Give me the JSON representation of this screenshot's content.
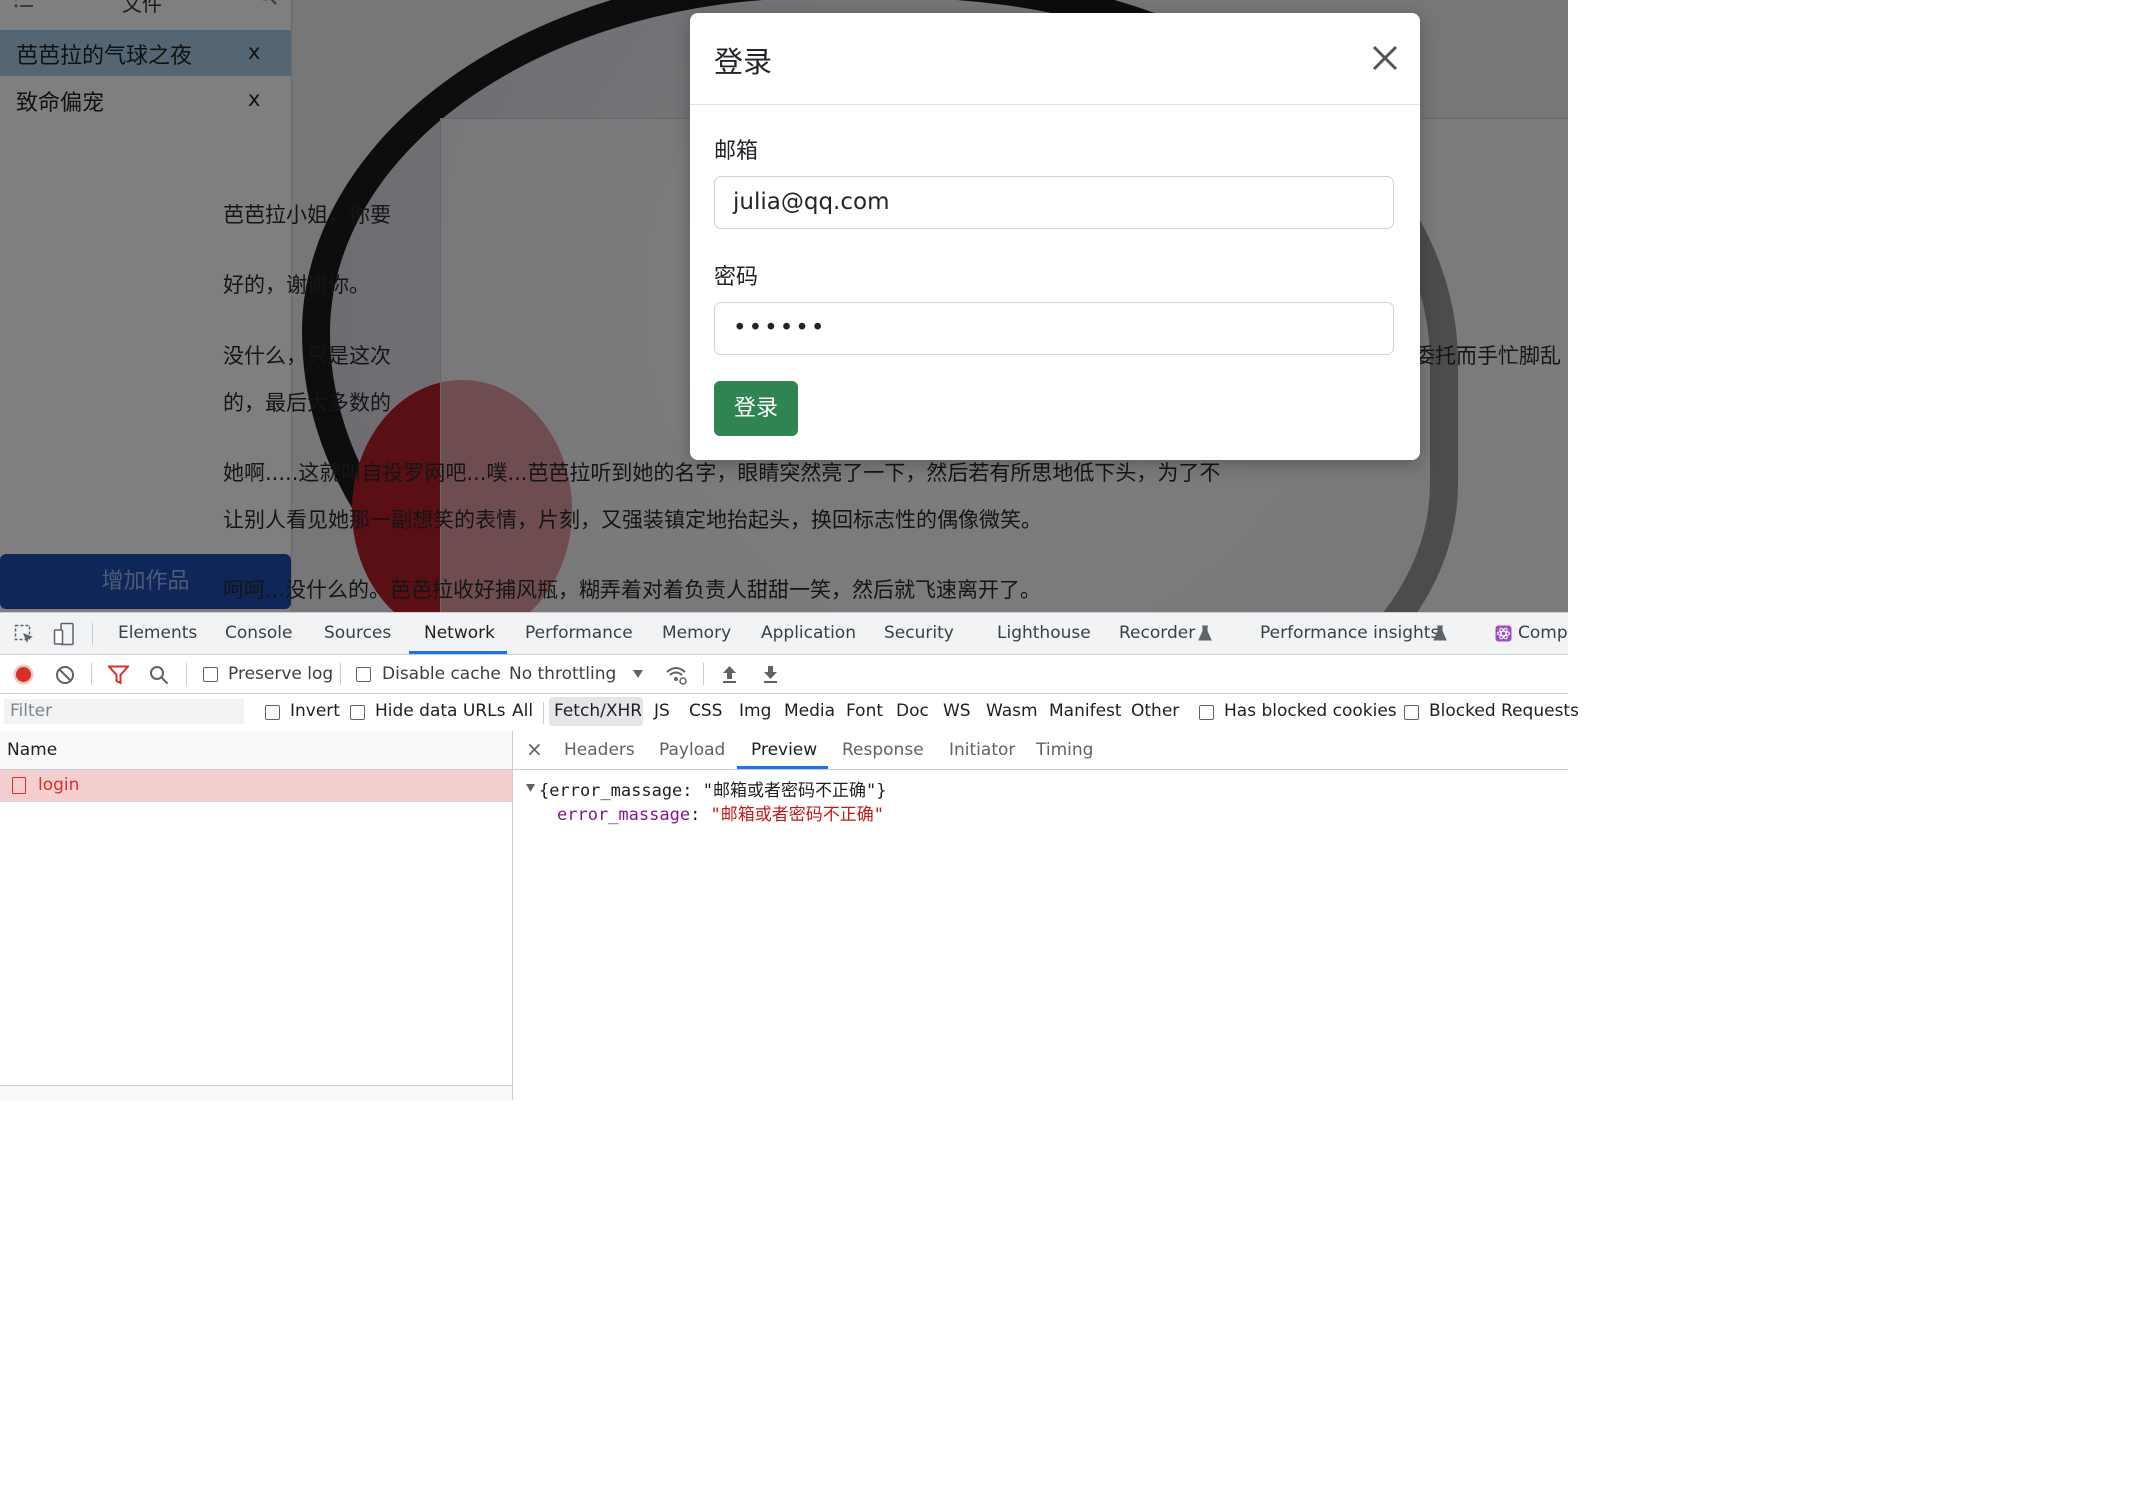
{
  "sidebar": {
    "title": "文件",
    "items": [
      {
        "label": "芭芭拉的气球之夜",
        "close": "x",
        "active": true
      },
      {
        "label": "致命偏宠",
        "close": "x",
        "active": false
      }
    ],
    "add_button": "增加作品"
  },
  "document": {
    "paragraphs": [
      "芭芭拉小姐，你要",
      "好的，谢谢你。",
      "没什么，只是这次",
      "委托而手忙脚乱",
      "的，最后大多数的",
      "她啊.....这就叫自投罗网吧...噗...芭芭拉听到她的名字，眼睛突然亮了一下，然后若有所思地低下头，为了不",
      "让别人看见她那一副想笑的表情，片刻，又强装镇定地抬起头，换回标志性的偶像微笑。",
      "呵呵...没什么的。芭芭拉收好捕风瓶，糊弄着对着负责人甜甜一笑，然后就飞速离开了。"
    ]
  },
  "modal": {
    "title": "登录",
    "email_label": "邮箱",
    "email_value": "julia@qq.com",
    "password_label": "密码",
    "password_value": "••••••",
    "submit_label": "登录"
  },
  "devtools": {
    "tabs": [
      "Elements",
      "Console",
      "Sources",
      "Network",
      "Performance",
      "Memory",
      "Application",
      "Security",
      "Lighthouse",
      "Recorder",
      "Performance insights",
      "Comp"
    ],
    "active_tab": "Network",
    "toolbar": {
      "preserve_log": "Preserve log",
      "disable_cache": "Disable cache",
      "throttling": "No throttling"
    },
    "filter": {
      "placeholder": "Filter",
      "invert": "Invert",
      "hide_data_urls": "Hide data URLs",
      "types": [
        "All",
        "Fetch/XHR",
        "JS",
        "CSS",
        "Img",
        "Media",
        "Font",
        "Doc",
        "WS",
        "Wasm",
        "Manifest",
        "Other"
      ],
      "active_type": "Fetch/XHR",
      "has_blocked_cookies": "Has blocked cookies",
      "blocked_requests": "Blocked Requests"
    },
    "requests": {
      "column_name": "Name",
      "rows": [
        {
          "name": "login",
          "status": "error"
        }
      ]
    },
    "detail": {
      "close": "×",
      "tabs": [
        "Headers",
        "Payload",
        "Preview",
        "Response",
        "Initiator",
        "Timing"
      ],
      "active_tab": "Preview",
      "preview": {
        "summary": "{error_massage: \"邮箱或者密码不正确\"}",
        "key": "error_massage",
        "value": "\"邮箱或者密码不正确\""
      }
    }
  },
  "colors": {
    "accent_blue": "#1a73e8",
    "submit_green": "#2f8451",
    "add_button_blue": "#1e4db5",
    "error_red": "#d93025"
  }
}
